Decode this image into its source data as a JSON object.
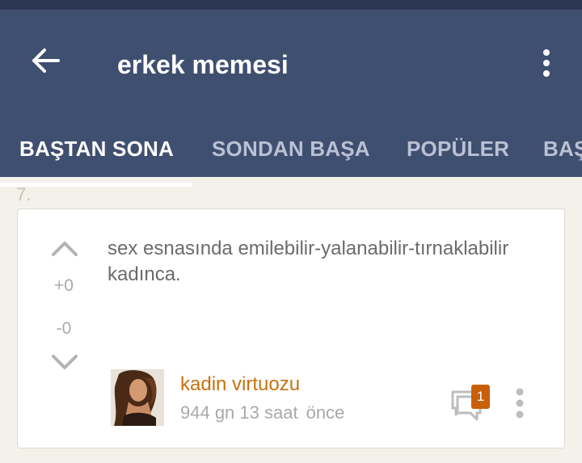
{
  "header": {
    "title": "erkek memesi",
    "back_icon": "arrow-left-icon",
    "menu_icon": "more-vertical-icon"
  },
  "tabs": [
    {
      "label": "BAŞTAN SONA",
      "active": true
    },
    {
      "label": "SONDAN BAŞA",
      "active": false
    },
    {
      "label": "POPÜLER",
      "active": false
    },
    {
      "label": "BAŞ",
      "active": false
    }
  ],
  "entry": {
    "index": "7.",
    "text": "sex esnasında emilebilir-yalanabilir-tırnaklabilir kadınca.",
    "votes": {
      "plus": "+0",
      "minus": "-0"
    },
    "author": "kadin virtuozu",
    "time_ago": "944 gn 13 saat",
    "time_suffix": "önce",
    "comment_count": "1"
  },
  "colors": {
    "appbar": "#3f4f70",
    "statusbar": "#2b3754",
    "background": "#f3f1ea",
    "accent_author": "#c8710d",
    "badge": "#c8600a"
  }
}
